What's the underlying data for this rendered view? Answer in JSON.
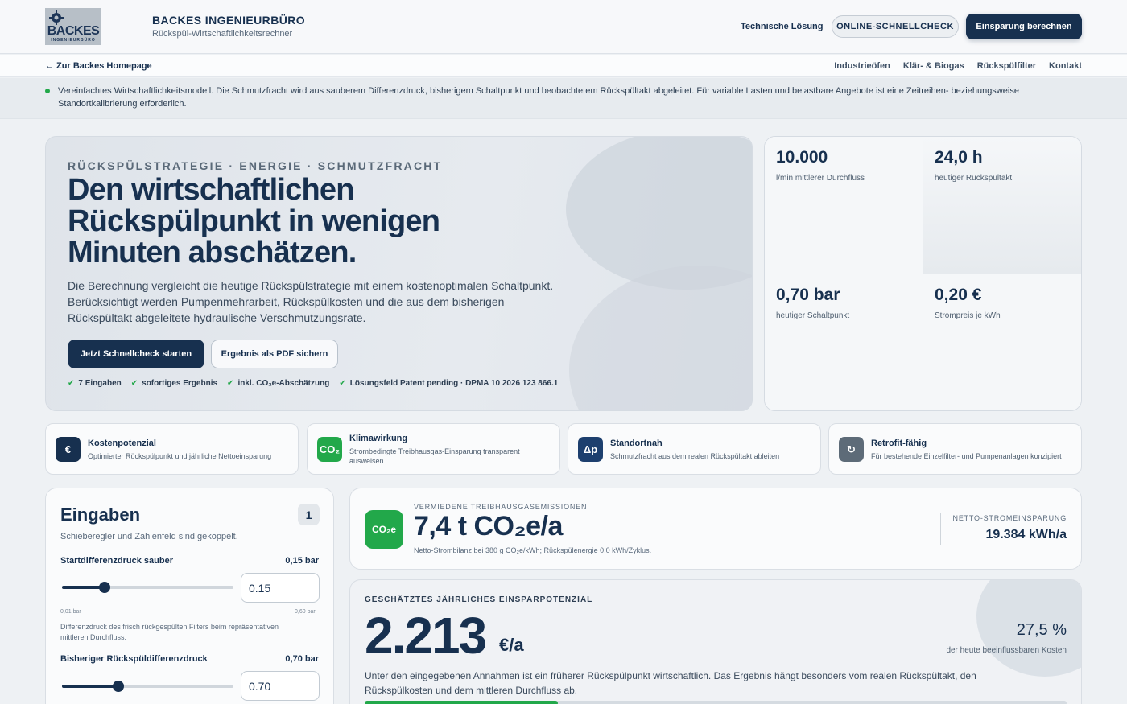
{
  "header": {
    "logo_brand": "BACKES",
    "logo_sub": "INGENIEURBÜRO",
    "title": "BACKES INGENIEURBÜRO",
    "subtitle": "Rückspül-Wirtschaftlichkeitsrechner",
    "nav_tech": "Technische Lösung",
    "btn_schnellcheck": "ONLINE-SCHNELLCHECK",
    "btn_einsparung": "Einsparung berechnen"
  },
  "subnav": {
    "back": "← Zur Backes Homepage",
    "links": [
      "Industrieöfen",
      "Klär- & Biogas",
      "Rückspülfilter",
      "Kontakt"
    ]
  },
  "notice": {
    "text": "Vereinfachtes Wirtschaftlichkeitsmodell. Die Schmutzfracht wird aus sauberem Differenzdruck, bisherigem Schaltpunkt und beobachtetem Rückspültakt abgeleitet. Für variable Lasten und belastbare Angebote ist eine Zeitreihen- beziehungsweise Standortkalibrierung erforderlich."
  },
  "hero": {
    "eyebrow": "RÜCKSPÜLSTRATEGIE · ENERGIE · SCHMUTZFRACHT",
    "title": "Den wirtschaftlichen Rückspülpunkt in wenigen Minuten abschätzen.",
    "description": "Die Berechnung vergleicht die heutige Rückspülstrategie mit einem kostenoptimalen Schaltpunkt. Berücksichtigt werden Pumpenmehrarbeit, Rückspülkosten und die aus dem bisherigen Rückspültakt abgeleitete hydraulische Verschmutzungsrate.",
    "btn_start": "Jetzt Schnellcheck starten",
    "btn_pdf": "Ergebnis als PDF sichern",
    "features": [
      "7 Eingaben",
      "sofortiges Ergebnis",
      "inkl. CO₂e-Abschätzung",
      "Lösungsfeld Patent pending · DPMA 10 2026 123 866.1"
    ]
  },
  "stats": [
    {
      "value": "10.000",
      "label": "l/min mittlerer Durchfluss"
    },
    {
      "value": "24,0 h",
      "label": "heutiger Rückspültakt"
    },
    {
      "value": "0,70 bar",
      "label": "heutiger Schaltpunkt"
    },
    {
      "value": "0,20 €",
      "label": "Strompreis je kWh"
    }
  ],
  "feature_cards": [
    {
      "icon": "€",
      "title": "Kostenpotenzial",
      "desc": "Optimierter Rückspülpunkt und jährliche Nettoeinsparung",
      "color": "#17304f"
    },
    {
      "icon": "CO₂",
      "title": "Klimawirkung",
      "desc": "Strombedingte Treibhausgas-Einsparung transparent ausweisen",
      "color": "#22a84a"
    },
    {
      "icon": "Δp",
      "title": "Standortnah",
      "desc": "Schmutzfracht aus dem realen Rückspültakt ableiten",
      "color": "#1d3f6e"
    },
    {
      "icon": "↻",
      "title": "Retrofit-fähig",
      "desc": "Für bestehende Einzelfilter- und Pumpenanlagen konzipiert",
      "color": "#5d6b78"
    }
  ],
  "inputs": {
    "title": "Eingaben",
    "step": "1",
    "hint": "Schieberegler und Zahlenfeld sind gekoppelt.",
    "fields": [
      {
        "label": "Startdifferenzdruck sauber",
        "display": "0,15 bar",
        "value": "0.15",
        "min": "0,01 bar",
        "max": "0,60 bar",
        "level": 0.25,
        "desc": "Differenzdruck des frisch rückgespülten Filters beim repräsentativen mittleren Durchfluss."
      },
      {
        "label": "Bisheriger Rückspüldifferenzdruck",
        "display": "0,70 bar",
        "value": "0.70",
        "level": 0.33
      }
    ]
  },
  "co2": {
    "badge": "CO₂e",
    "eyebrow": "VERMIEDENE TREIBHAUSGASEMISSIONEN",
    "value": "7,4 t CO₂e/a",
    "note": "Netto-Strombilanz bei 380 g CO₂e/kWh; Rückspülenergie 0,0 kWh/Zyklus.",
    "right_label": "NETTO-STROMEINSPARUNG",
    "right_value": "19.384 kWh/a"
  },
  "savings": {
    "eyebrow": "GESCHÄTZTES JÄHRLICHES EINSPARPOTENZIAL",
    "value": "2.213",
    "unit": "€/a",
    "percent": "27,5 %",
    "percent_label": "der heute beeinflussbaren Kosten",
    "desc": "Unter den eingegebenen Annahmen ist ein früherer Rückspülpunkt wirtschaftlich. Das Ergebnis hängt besonders vom realen Rückspültakt, den Rückspülkosten und dem mittleren Durchfluss ab.",
    "progress": 0.275
  }
}
